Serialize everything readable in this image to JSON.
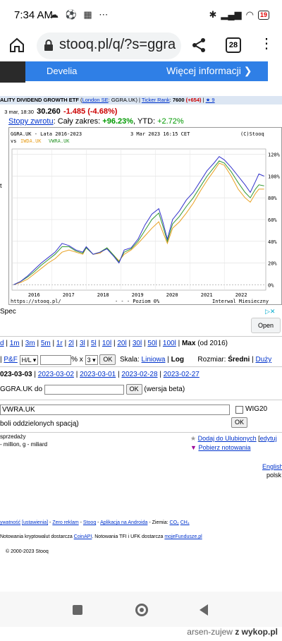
{
  "status": {
    "time": "7:34 AM",
    "icons": "☁ ⚽ ▦ ⋯",
    "battery": "19"
  },
  "browser": {
    "url": "stooq.pl/q/?s=ggra",
    "tab_count": "28"
  },
  "ad_banner": {
    "brand": "Develia",
    "more": "Więcej informacji ❯"
  },
  "stock": {
    "name": "ALITY DIVIDEND GROWTH ETF",
    "market_link": "London SE",
    "symbol": "GGRA.UK",
    "ticker_rank_link": "Ticker Rank",
    "ticker_rank_value": "7600",
    "ticker_rank_change": "(+654)",
    "stars": "★ 9",
    "quote_time": "3 mar, 18:30",
    "price": "30.260",
    "change": "-1.485 (-4.68%)",
    "returns_link": "Stopy zwrotu",
    "returns_all_label": ": Cały zakres:",
    "returns_all": "+96.23%",
    "returns_ytd_label": ", YTD:",
    "returns_ytd": "+2.72%"
  },
  "chart_left_stub": "t",
  "chart_data": {
    "type": "line",
    "header_left": "GGRA.UK - Lata 2016-2023",
    "header_mid": "3 Mar 2023 16:15 CET",
    "header_right": "(C)Stooq",
    "vs_label": "vs",
    "x_ticks": [
      "2016",
      "2017",
      "2018",
      "2019",
      "2020",
      "2021",
      "2022"
    ],
    "y_ticks": [
      "0%",
      "20%",
      "40%",
      "60%",
      "80%",
      "100%",
      "120%"
    ],
    "ylim": [
      -5,
      125
    ],
    "xlim": [
      2015.85,
      2023.2
    ],
    "footer_left": "https://stooq.pl/",
    "footer_mid": "- - - Poziom 0%",
    "footer_right": "Interwal Miesieczny",
    "series": [
      {
        "name": "GGRA.UK",
        "color": "#3333cc",
        "x": [
          2015.9,
          2016.1,
          2016.3,
          2016.5,
          2016.7,
          2016.9,
          2017.1,
          2017.3,
          2017.5,
          2017.7,
          2017.9,
          2018.0,
          2018.2,
          2018.4,
          2018.6,
          2018.8,
          2018.95,
          2019.1,
          2019.3,
          2019.5,
          2019.7,
          2019.9,
          2020.1,
          2020.2,
          2020.35,
          2020.5,
          2020.7,
          2020.9,
          2021.1,
          2021.3,
          2021.5,
          2021.7,
          2021.85,
          2022.0,
          2022.2,
          2022.4,
          2022.6,
          2022.75,
          2022.9,
          2023.0,
          2023.15
        ],
        "y": [
          0,
          3,
          8,
          14,
          20,
          25,
          30,
          38,
          36,
          32,
          30,
          35,
          28,
          30,
          33,
          26,
          20,
          32,
          34,
          42,
          55,
          65,
          70,
          60,
          42,
          60,
          68,
          78,
          85,
          95,
          105,
          112,
          118,
          115,
          108,
          100,
          92,
          85,
          95,
          102,
          100
        ]
      },
      {
        "name": "IWDA.UK",
        "color": "#e8a020",
        "x": [
          2015.9,
          2016.1,
          2016.3,
          2016.5,
          2016.7,
          2016.9,
          2017.1,
          2017.3,
          2017.5,
          2017.7,
          2017.9,
          2018.0,
          2018.2,
          2018.4,
          2018.6,
          2018.8,
          2018.95,
          2019.1,
          2019.3,
          2019.5,
          2019.7,
          2019.9,
          2020.1,
          2020.2,
          2020.35,
          2020.5,
          2020.7,
          2020.9,
          2021.1,
          2021.3,
          2021.5,
          2021.7,
          2021.85,
          2022.0,
          2022.2,
          2022.4,
          2022.6,
          2022.75,
          2022.9,
          2023.0,
          2023.15
        ],
        "y": [
          0,
          2,
          5,
          10,
          15,
          20,
          24,
          30,
          32,
          30,
          28,
          34,
          28,
          29,
          34,
          27,
          22,
          28,
          32,
          38,
          45,
          52,
          58,
          50,
          38,
          52,
          58,
          66,
          75,
          86,
          96,
          105,
          112,
          110,
          100,
          88,
          80,
          76,
          84,
          88,
          88
        ]
      },
      {
        "name": "VWRA.UK",
        "color": "#339933",
        "x": [
          2015.9,
          2016.1,
          2016.3,
          2016.5,
          2016.7,
          2016.9,
          2017.1,
          2017.3,
          2017.5,
          2017.7,
          2017.9,
          2018.0,
          2018.2,
          2018.4,
          2018.6,
          2018.8,
          2018.95,
          2019.1,
          2019.3,
          2019.5,
          2019.7,
          2019.9,
          2020.1,
          2020.2,
          2020.35,
          2020.5,
          2020.7,
          2020.9,
          2021.1,
          2021.3,
          2021.5,
          2021.7,
          2021.85,
          2022.0,
          2022.2,
          2022.4,
          2022.6,
          2022.75,
          2022.9,
          2023.0,
          2023.15
        ],
        "y": [
          0,
          3,
          7,
          12,
          18,
          23,
          28,
          35,
          35,
          31,
          29,
          34,
          28,
          30,
          34,
          27,
          21,
          30,
          33,
          40,
          50,
          60,
          66,
          56,
          40,
          56,
          63,
          72,
          80,
          90,
          100,
          108,
          114,
          112,
          104,
          94,
          85,
          80,
          88,
          92,
          91
        ]
      }
    ]
  },
  "google_ad": {
    "title": "Spec",
    "open": "Open",
    "adchoice": "▷✕"
  },
  "ranges": {
    "items": [
      "1m",
      "3m",
      "5m",
      "1r",
      "2l",
      "3l",
      "5l",
      "10l",
      "20l",
      "30l",
      "50l",
      "100l"
    ],
    "selected": "Max",
    "selected_note": "(od 2016)",
    "first_fragment": "d"
  },
  "controls": {
    "pf_link": "P&F",
    "pf_select": "H/L",
    "pct_x": "% x",
    "mult_select": "3",
    "ok": "OK",
    "scale_label": "Skala:",
    "scale_linear": "Liniowa",
    "scale_log": "Log",
    "size_label": "Rozmiar:",
    "size_medium": "Średni",
    "size_large": "Duży"
  },
  "dates": {
    "current": "023-03-03",
    "links": [
      "2023-03-02",
      "2023-03-01",
      "2023-02-28",
      "2023-02-27"
    ]
  },
  "compare": {
    "label": "GGRA.UK do",
    "ok": "OK",
    "note": "(wersja beta)"
  },
  "multi": {
    "value": "VWRA.UK",
    "wig": "WIG20",
    "ok": "OK",
    "hint": "boli oddzielonych spacją)"
  },
  "info": {
    "line1": "sprzedaży",
    "line2": "- million, g - miliard",
    "fav": "Dodaj do Ulubionych",
    "edit": "edytuj",
    "download": "Pobierz notowania",
    "lang1": "English",
    "lang2": "polsk"
  },
  "footer": {
    "l1_a": "ywatność",
    "l1_b": "[ustawienia]",
    "l1_c": "Zero reklam",
    "l1_d": "Stooq",
    "l1_e": "Aplikacja na Androida",
    "l1_f": "- Ziemia:",
    "l1_g": "CO₂",
    "l1_h": "CH₄",
    "l2": "Notowania kryptowalut dostarcza",
    "l2_link": "CoinAPI",
    "l2_b": ". Notowania TFI i UFK dostarcza",
    "l2_link2": "mojeFundusze.pl",
    "l3": "© 2000-2023 Stooq"
  },
  "watermark": {
    "user": "arsen-zujew",
    "site": "z wykop.pl"
  }
}
